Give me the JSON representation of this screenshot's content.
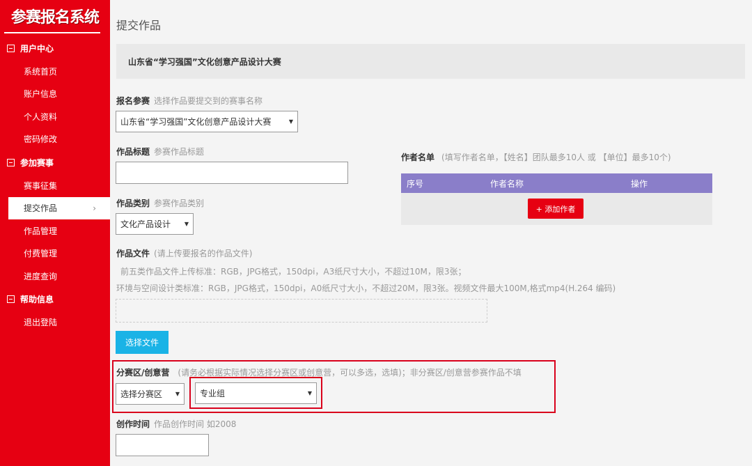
{
  "app": {
    "logo": "参赛报名系统"
  },
  "sidebar": {
    "groups": [
      {
        "label": "用户中心",
        "items": [
          "系统首页",
          "账户信息",
          "个人资料",
          "密码修改"
        ]
      },
      {
        "label": "参加赛事",
        "items": [
          "赛事征集",
          "提交作品",
          "作品管理",
          "付费管理",
          "进度查询"
        ]
      },
      {
        "label": "帮助信息",
        "items": [
          "退出登陆"
        ]
      }
    ],
    "active_item": "提交作品",
    "active_chevron": "›"
  },
  "page": {
    "title": "提交作品",
    "banner": "山东省“学习强国”文化创意产品设计大赛"
  },
  "form": {
    "contest": {
      "label": "报名参赛",
      "hint": "选择作品要提交到的赛事名称",
      "value": "山东省“学习强国”文化创意产品设计大赛"
    },
    "title": {
      "label": "作品标题",
      "hint": "参赛作品标题",
      "value": ""
    },
    "category": {
      "label": "作品类别",
      "hint": "参赛作品类别",
      "value": "文化产品设计"
    },
    "file": {
      "label": "作品文件",
      "hint": "(请上传要报名的作品文件)",
      "note1": "前五类作品文件上传标准：RGB，JPG格式，150dpi，A3纸尺寸大小，不超过10M，限3张；",
      "note2": "环境与空间设计类标准：RGB，JPG格式，150dpi，A0纸尺寸大小，不超过20M，限3张。视频文件最大100M,格式mp4(H.264 编码)",
      "button": "选择文件"
    },
    "division": {
      "label": "分赛区/创意营",
      "hint": "(请务必根据实际情况选择分赛区或创意营，可以多选，选填)；非分赛区/创意营参赛作品不填",
      "select1": "选择分赛区",
      "select2": "专业组"
    },
    "year": {
      "label": "创作时间",
      "hint": "作品创作时间 如2008",
      "value": ""
    }
  },
  "authors": {
    "label": "作者名单",
    "hint": "(填写作者名单，【姓名】团队最多10人 或 【单位】最多10个)",
    "columns": [
      "序号",
      "作者名称",
      "操作"
    ],
    "add_button": "+ 添加作者"
  },
  "colors": {
    "sidebar": "#e60012",
    "header_purple": "#8a7ec9",
    "button_blue": "#1ab3e6",
    "highlight": "#d9001b"
  }
}
